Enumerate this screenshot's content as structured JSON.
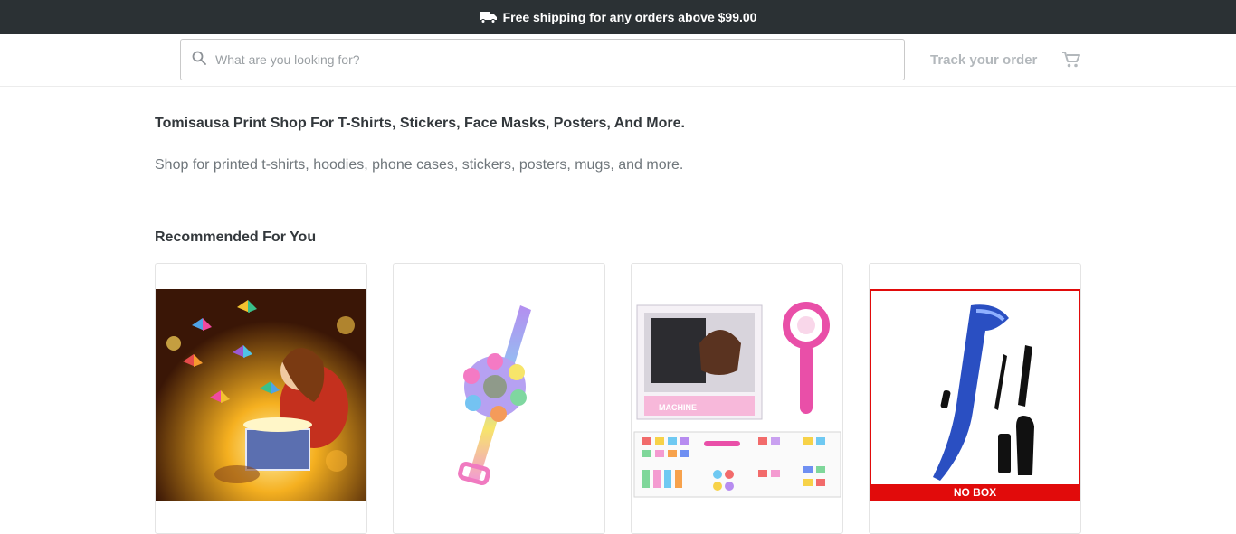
{
  "banner": {
    "text": "Free shipping for any orders above $99.00",
    "icon": "truck-icon"
  },
  "header": {
    "search_placeholder": "What are you looking for?",
    "track_order_label": "Track your order",
    "cart_icon": "cart-icon"
  },
  "intro": {
    "title": "Tomisausa Print Shop For T-Shirts, Stickers, Face Masks, Posters, And More.",
    "subtitle": "Shop for printed t-shirts, hoodies, phone cases, stickers, posters, mugs, and more."
  },
  "recommended": {
    "title": "Recommended For You",
    "products": [
      {
        "image": "girl-opening-butterfly-gift-box"
      },
      {
        "image": "fidget-spinner-pop-bracelet"
      },
      {
        "image": "hair-braiding-machine-kit"
      },
      {
        "image": "automatic-hair-curler",
        "badge": "NO BOX"
      }
    ]
  },
  "colors": {
    "banner_bg": "#2b3134",
    "badge_red": "#e10b0b"
  }
}
